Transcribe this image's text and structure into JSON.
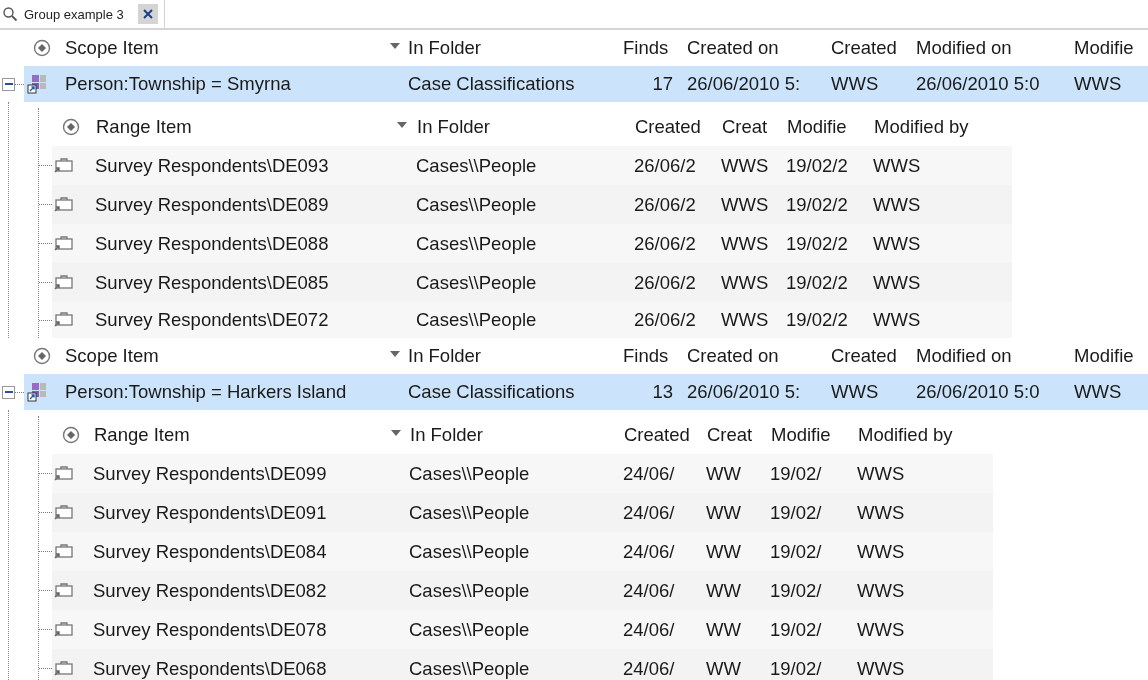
{
  "tab": {
    "title": "Group example 3",
    "selected": true
  },
  "groups": [
    {
      "scope_columns": [
        "Scope Item",
        "In Folder",
        "Finds",
        "Created on",
        "Created",
        "Modified on",
        "Modifie"
      ],
      "scope": {
        "name": "Person:Township = Smyrna",
        "folder": "Case Classifications",
        "finds": "17",
        "created_on": "26/06/2010 5:",
        "created": "WWS",
        "modified_on": "26/06/2010 5:0",
        "modified": "WWS",
        "expanded": true
      },
      "range_columns": [
        "Range Item",
        "In Folder",
        "Created",
        "Creat",
        "Modifie",
        "Modified by"
      ],
      "rows": [
        {
          "name": "Survey Respondents\\DE093",
          "folder": "Cases\\\\People",
          "created": "26/06/2",
          "creat": "WWS",
          "modified": "19/02/2",
          "modified_by": "WWS"
        },
        {
          "name": "Survey Respondents\\DE089",
          "folder": "Cases\\\\People",
          "created": "26/06/2",
          "creat": "WWS",
          "modified": "19/02/2",
          "modified_by": "WWS"
        },
        {
          "name": "Survey Respondents\\DE088",
          "folder": "Cases\\\\People",
          "created": "26/06/2",
          "creat": "WWS",
          "modified": "19/02/2",
          "modified_by": "WWS"
        },
        {
          "name": "Survey Respondents\\DE085",
          "folder": "Cases\\\\People",
          "created": "26/06/2",
          "creat": "WWS",
          "modified": "19/02/2",
          "modified_by": "WWS"
        },
        {
          "name": "Survey Respondents\\DE072",
          "folder": "Cases\\\\People",
          "created": "26/06/2",
          "creat": "WWS",
          "modified": "19/02/2",
          "modified_by": "WWS"
        }
      ]
    },
    {
      "scope_columns": [
        "Scope Item",
        "In Folder",
        "Finds",
        "Created on",
        "Created",
        "Modified on",
        "Modifie"
      ],
      "scope": {
        "name": "Person:Township = Harkers Island",
        "folder": "Case Classifications",
        "finds": "13",
        "created_on": "26/06/2010 5:",
        "created": "WWS",
        "modified_on": "26/06/2010 5:0",
        "modified": "WWS",
        "expanded": true
      },
      "range_columns": [
        "Range Item",
        "In Folder",
        "Created",
        "Creat",
        "Modifie",
        "Modified by"
      ],
      "rows": [
        {
          "name": "Survey Respondents\\DE099",
          "folder": "Cases\\\\People",
          "created": "24/06/",
          "creat": "WW",
          "modified": "19/02/",
          "modified_by": "WWS"
        },
        {
          "name": "Survey Respondents\\DE091",
          "folder": "Cases\\\\People",
          "created": "24/06/",
          "creat": "WW",
          "modified": "19/02/",
          "modified_by": "WWS"
        },
        {
          "name": "Survey Respondents\\DE084",
          "folder": "Cases\\\\People",
          "created": "24/06/",
          "creat": "WW",
          "modified": "19/02/",
          "modified_by": "WWS"
        },
        {
          "name": "Survey Respondents\\DE082",
          "folder": "Cases\\\\People",
          "created": "24/06/",
          "creat": "WW",
          "modified": "19/02/",
          "modified_by": "WWS"
        },
        {
          "name": "Survey Respondents\\DE078",
          "folder": "Cases\\\\People",
          "created": "24/06/",
          "creat": "WW",
          "modified": "19/02/",
          "modified_by": "WWS"
        },
        {
          "name": "Survey Respondents\\DE068",
          "folder": "Cases\\\\People",
          "created": "24/06/",
          "creat": "WW",
          "modified": "19/02/",
          "modified_by": "WWS"
        }
      ]
    }
  ]
}
